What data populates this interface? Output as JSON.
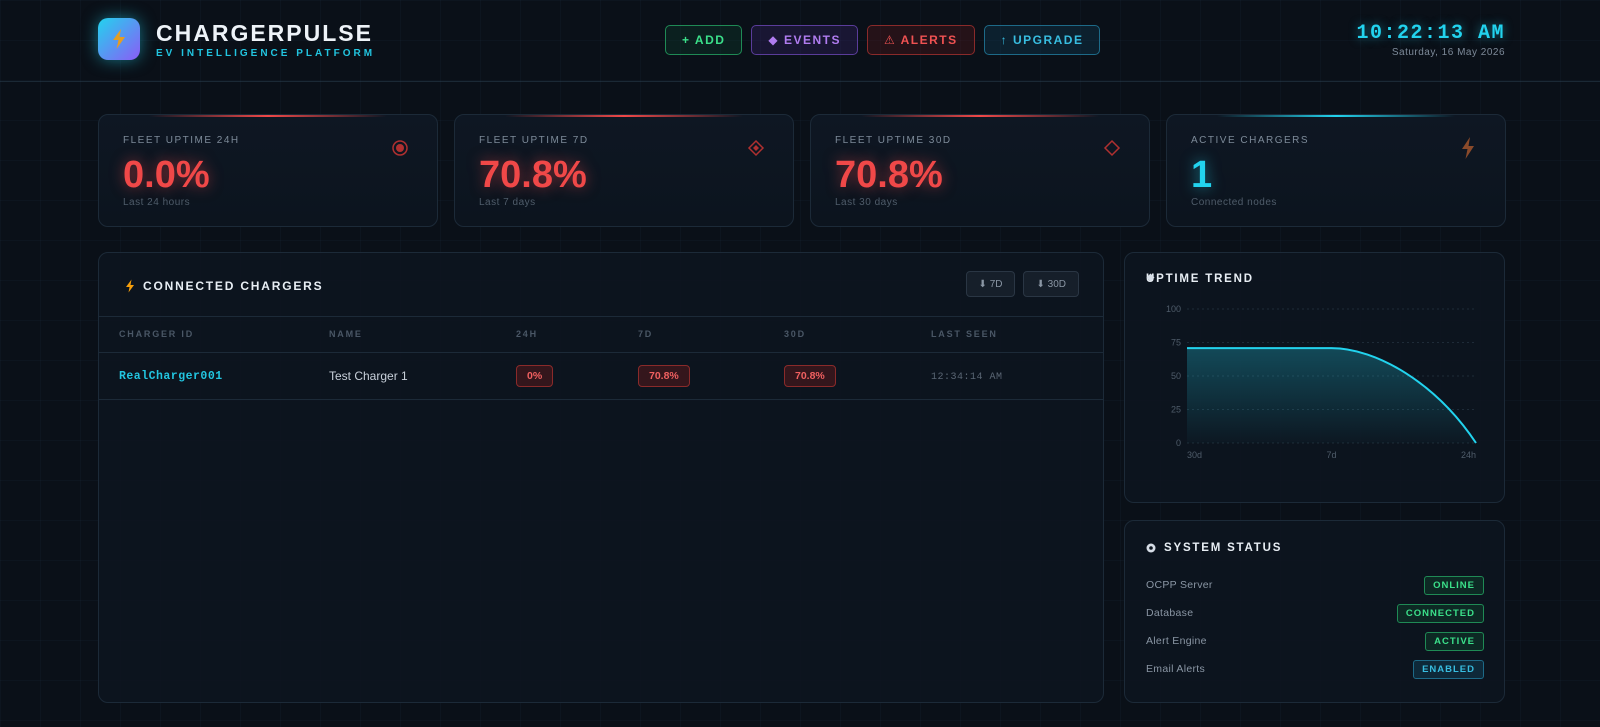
{
  "brand": {
    "title": "CHARGERPULSE",
    "subtitle": "EV INTELLIGENCE PLATFORM",
    "logo_icon": "lightning-bolt-icon"
  },
  "nav": {
    "add": "+ ADD",
    "events": "◆ EVENTS",
    "alerts": "⚠ ALERTS",
    "upgrade": "↑ UPGRADE"
  },
  "clock": {
    "time": "10:22:13 AM",
    "date": "Saturday, 16 May 2026"
  },
  "stats": [
    {
      "label": "FLEET UPTIME 24H",
      "value": "0.0%",
      "sub": "Last 24 hours",
      "icon": "target-icon",
      "accent": "#f04848"
    },
    {
      "label": "FLEET UPTIME 7D",
      "value": "70.8%",
      "sub": "Last 7 days",
      "icon": "diamond-dot-icon",
      "accent": "#f04848"
    },
    {
      "label": "FLEET UPTIME 30D",
      "value": "70.8%",
      "sub": "Last 30 days",
      "icon": "diamond-outline-icon",
      "accent": "#f04848"
    },
    {
      "label": "ACTIVE CHARGERS",
      "value": "1",
      "sub": "Connected nodes",
      "icon": "lightning-bolt-icon",
      "accent": "#22d3ee"
    }
  ],
  "chargers": {
    "title": "CONNECTED CHARGERS",
    "range_7d": "⬇ 7D",
    "range_30d": "⬇ 30D",
    "columns": [
      "CHARGER ID",
      "NAME",
      "24H",
      "7D",
      "30D",
      "LAST SEEN"
    ],
    "rows": [
      {
        "id": "RealCharger001",
        "name": "Test Charger 1",
        "h24": "0%",
        "d7": "70.8%",
        "d30": "70.8%",
        "last_seen": "12:34:14 AM"
      }
    ]
  },
  "trend": {
    "title": "UPTIME TREND",
    "title_icon": "diamond-icon"
  },
  "chart_data": {
    "type": "area",
    "title": "UPTIME TREND",
    "x": [
      "30d",
      "7d",
      "24h"
    ],
    "series": [
      {
        "values": [
          70.8,
          70.8,
          0
        ]
      }
    ],
    "ylim": [
      0,
      100
    ],
    "yticks": [
      0,
      25,
      50,
      75,
      100
    ],
    "xlabel": "",
    "ylabel": "",
    "grid": true,
    "color": "#22d3ee"
  },
  "system_status": {
    "title": "SYSTEM STATUS",
    "title_icon": "circle-status-icon",
    "items": [
      {
        "label": "OCPP Server",
        "status": "ONLINE",
        "color": "green"
      },
      {
        "label": "Database",
        "status": "CONNECTED",
        "color": "green"
      },
      {
        "label": "Alert Engine",
        "status": "ACTIVE",
        "color": "green"
      },
      {
        "label": "Email Alerts",
        "status": "ENABLED",
        "color": "cyan"
      }
    ]
  }
}
